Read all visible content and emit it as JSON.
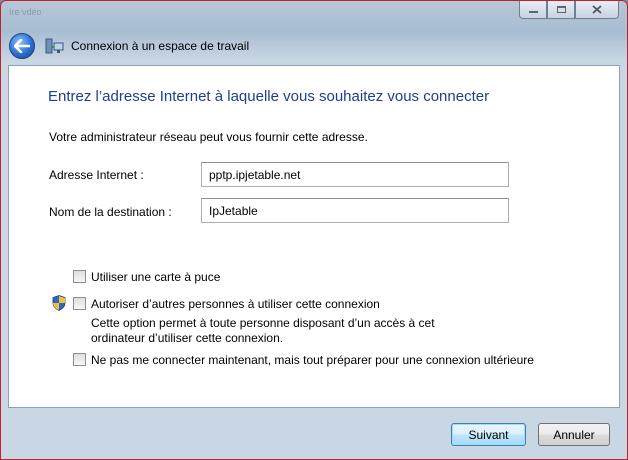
{
  "window": {
    "ghost_title": "Ire vdéo",
    "caption": {
      "minimize": "minimize-icon",
      "maximize": "maximize-icon",
      "close": "close-icon"
    }
  },
  "nav": {
    "back_icon": "back-arrow-icon",
    "wizard_icon": "network-connection-icon",
    "title": "Connexion à un espace de travail"
  },
  "main": {
    "heading": "Entrez l’adresse Internet à laquelle vous souhaitez vous connecter",
    "description": "Votre administrateur réseau peut vous fournir cette adresse.",
    "fields": [
      {
        "label": "Adresse Internet :",
        "value": "pptp.ipjetable.net"
      },
      {
        "label": "Nom de la destination :",
        "value": "IpJetable"
      }
    ],
    "options": [
      {
        "label": "Utiliser une carte à puce",
        "checked": false
      },
      {
        "label": "Autoriser d’autres personnes à utiliser cette connexion",
        "checked": false,
        "icon": "uac-shield-icon",
        "sub_text": "Cette option permet à toute personne disposant d’un accès à cet ordinateur d’utiliser cette connexion."
      },
      {
        "label": "Ne pas me connecter maintenant, mais tout préparer pour une connexion ultérieure",
        "checked": false
      }
    ]
  },
  "footer": {
    "next_label": "Suivant",
    "cancel_label": "Annuler"
  },
  "colors": {
    "heading": "#1e3f8f",
    "frame_border": "#c0222a"
  }
}
